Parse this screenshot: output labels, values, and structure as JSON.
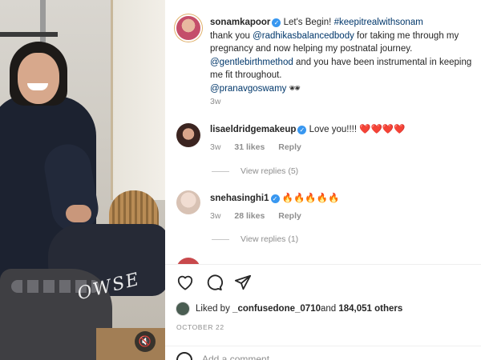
{
  "photo": {
    "watermark_text": "OWSE",
    "mute_icon": "speaker-muted-icon"
  },
  "caption": {
    "username": "sonamkapoor",
    "verified": true,
    "lines": [
      {
        "text": "Let's Begin! ",
        "link": "#keepitrealwithsonam"
      },
      {
        "pre": "thank you ",
        "link": "@radhikasbalancedbody",
        "post": " for taking me through my pregnancy and now helping my postnatal journey."
      },
      {
        "link": "@gentlebirthmethod",
        "post": " and you have been instrumental in keeping me fit throughout."
      },
      {
        "link": "@pranavgoswamy",
        "post": " 🕶"
      }
    ],
    "time": "3w"
  },
  "comments": [
    {
      "username": "lisaeldridgemakeup",
      "verified": true,
      "text": "Love you!!!! ❤️❤️❤️❤️",
      "time": "3w",
      "likes": "31 likes",
      "reply": "Reply",
      "view_replies": "View replies (5)"
    },
    {
      "username": "snehasinghi1",
      "verified": true,
      "text": "🔥🔥🔥🔥🔥",
      "time": "3w",
      "likes": "28 likes",
      "reply": "Reply",
      "view_replies": "View replies (1)"
    }
  ],
  "actions": {
    "like_icon": "heart-icon",
    "comment_icon": "comment-bubble-icon",
    "share_icon": "paper-plane-icon"
  },
  "likes": {
    "prefix": "Liked by ",
    "user": "_confusedone_0710",
    "middle": " and ",
    "others": "184,051 others"
  },
  "date": "OCTOBER 22",
  "add_comment": {
    "placeholder": "Add a comment..."
  },
  "colors": {
    "link": "#00376b",
    "verified": "#3897f0",
    "muted": "#8e8e8e",
    "text": "#262626"
  }
}
